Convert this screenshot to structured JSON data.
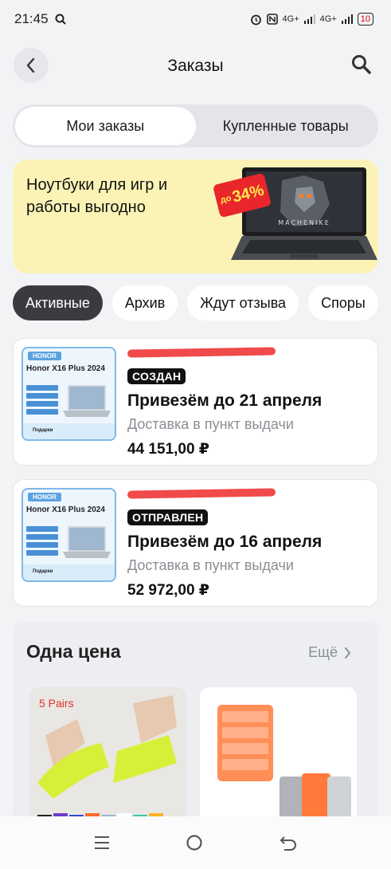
{
  "status_bar": {
    "time": "21:45",
    "signal1": "4G+",
    "signal2": "4G+",
    "battery": "10"
  },
  "header": {
    "title": "Заказы"
  },
  "segments": [
    {
      "label": "Мои заказы",
      "active": true
    },
    {
      "label": "Купленные товары",
      "active": false
    }
  ],
  "promo": {
    "text": "Ноутбуки для игр и работы выгодно",
    "discount_prefix": "до",
    "discount_value": "34%",
    "laptop_brand": "MACHENIKE"
  },
  "filters": [
    {
      "label": "Активные",
      "active": true
    },
    {
      "label": "Архив",
      "active": false
    },
    {
      "label": "Ждут отзыва",
      "active": false
    },
    {
      "label": "Споры",
      "active": false
    }
  ],
  "orders": [
    {
      "thumb_brand": "HONOR",
      "thumb_model": "Honor X16 Plus 2024",
      "thumb_gifts": "Подарки",
      "status": "СОЗДАН",
      "title": "Привезём до 21 апреля",
      "delivery": "Доставка в пункт выдачи",
      "price": "44 151,00 ₽"
    },
    {
      "thumb_brand": "HONOR",
      "thumb_model": "Honor X16 Plus 2024",
      "thumb_gifts": "Подарки",
      "status": "ОТПРАВЛЕН",
      "title": "Привезём до 16 апреля",
      "delivery": "Доставка в пункт выдачи",
      "price": "52 972,00 ₽"
    }
  ],
  "same_price": {
    "title": "Одна цена",
    "more": "Ещё",
    "products": [
      {
        "tag": "5 Pairs"
      },
      {
        "tag": ""
      }
    ]
  },
  "colors": {
    "accent_dark": "#3a3b3e",
    "promo_bg": "#fbf3b6",
    "discount_red": "#e8262b",
    "redact": "#f04a4a"
  }
}
